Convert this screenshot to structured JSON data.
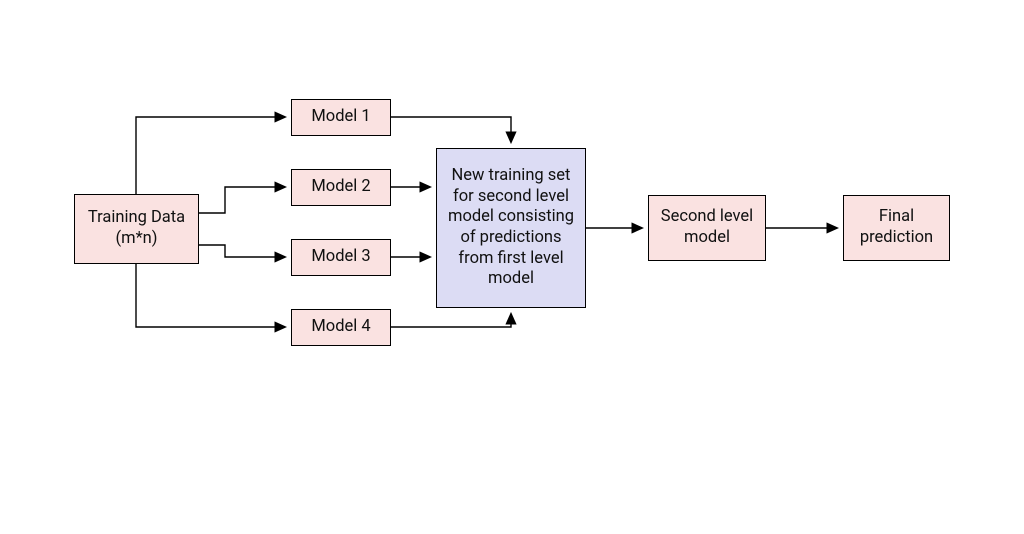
{
  "nodes": {
    "training_data": {
      "line1": "Training Data",
      "line2": "(m*n)"
    },
    "model1": "Model 1",
    "model2": "Model 2",
    "model3": "Model 3",
    "model4": "Model 4",
    "new_training_set": "New training set for second level model consisting of predictions from first level model",
    "second_level_model": "Second level model",
    "final_prediction": "Final prediction"
  },
  "colors": {
    "pink": "#fae2e1",
    "purple": "#dcdcf4"
  }
}
